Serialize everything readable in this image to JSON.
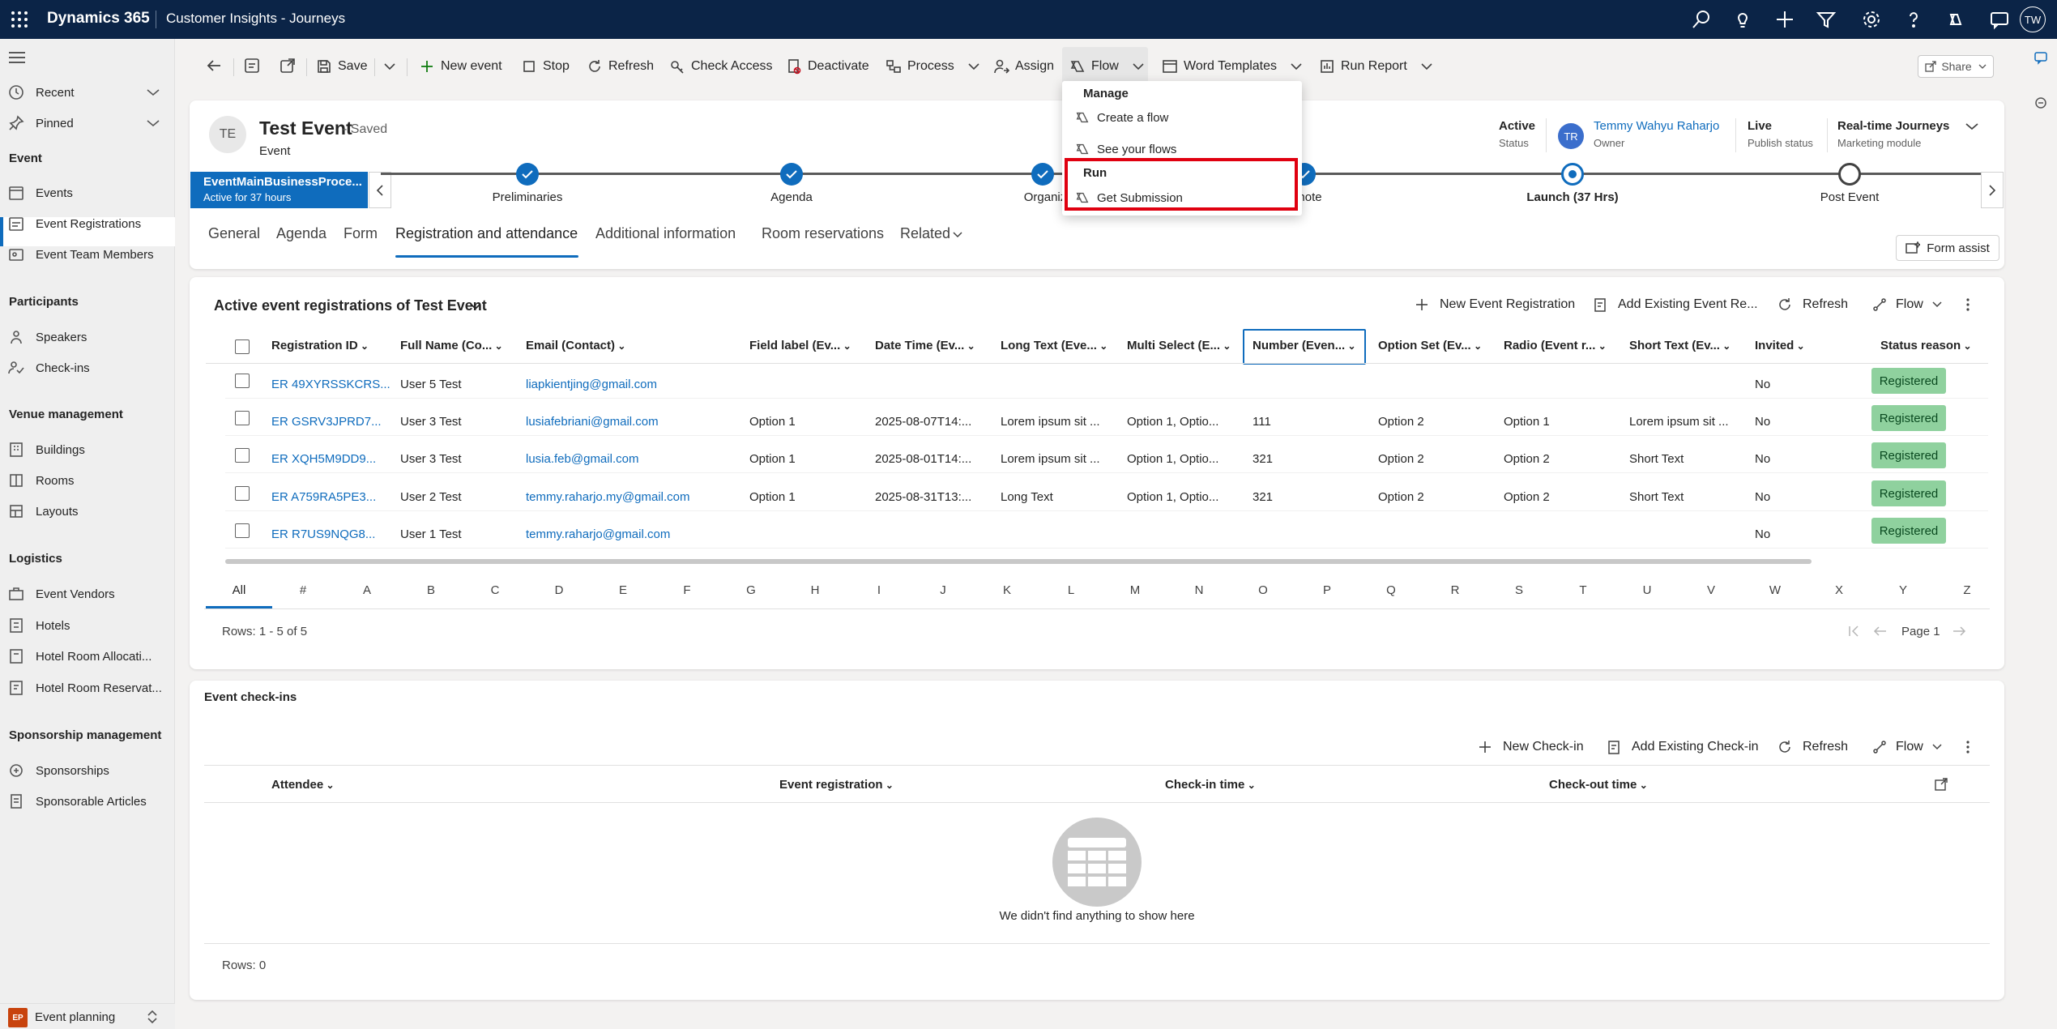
{
  "topbar": {
    "brand": "Dynamics 365",
    "app": "Customer Insights - Journeys",
    "user_initials": "TW",
    "icons": [
      "search-icon",
      "lightbulb-icon",
      "add-icon",
      "filter-icon",
      "settings-icon",
      "help-icon",
      "copilot-icon",
      "chat-icon"
    ]
  },
  "sidebar": {
    "top": [
      {
        "label": "Recent",
        "icon": "clock-icon"
      },
      {
        "label": "Pinned",
        "icon": "pin-icon"
      }
    ],
    "groups": [
      {
        "title": "Event",
        "items": [
          "Events",
          "Event Registrations",
          "Event Team Members"
        ]
      },
      {
        "title": "Participants",
        "items": [
          "Speakers",
          "Check-ins"
        ]
      },
      {
        "title": "Venue management",
        "items": [
          "Buildings",
          "Rooms",
          "Layouts"
        ]
      },
      {
        "title": "Logistics",
        "items": [
          "Event Vendors",
          "Hotels",
          "Hotel Room Allocati...",
          "Hotel Room Reservat..."
        ]
      },
      {
        "title": "Sponsorship management",
        "items": [
          "Sponsorships",
          "Sponsorable Articles"
        ]
      }
    ],
    "area": {
      "badge": "EP",
      "name": "Event planning"
    }
  },
  "command_bar": {
    "save": "Save",
    "new_event": "New event",
    "stop": "Stop",
    "refresh": "Refresh",
    "check_access": "Check Access",
    "deactivate": "Deactivate",
    "process": "Process",
    "assign": "Assign",
    "flow": "Flow",
    "word_templates": "Word Templates",
    "run_report": "Run Report",
    "share": "Share"
  },
  "flow_menu": {
    "manage": "Manage",
    "create": "Create a flow",
    "see": "See your flows",
    "run": "Run",
    "get_submission": "Get Submission"
  },
  "record": {
    "initials": "TE",
    "title": "Test Event",
    "saved": "- Saved",
    "type": "Event",
    "status_value": "Active",
    "status_label": "Status",
    "owner_initials": "TR",
    "owner_name": "Temmy Wahyu Raharjo",
    "owner_label": "Owner",
    "publish_value": "Live",
    "publish_label": "Publish status",
    "module_value": "Real-time Journeys",
    "module_label": "Marketing module"
  },
  "bpf": {
    "active_title": "EventMainBusinessProce...",
    "active_sub": "Active for 37 hours",
    "stages": [
      "Preliminaries",
      "Agenda",
      "Organiz",
      "note",
      "Launch  (37 Hrs)",
      "Post Event"
    ]
  },
  "tabs": [
    "General",
    "Agenda",
    "Form",
    "Registration and attendance",
    "Additional information",
    "Room reservations",
    "Related"
  ],
  "form_assist": "Form assist",
  "registrations": {
    "title": "Active event registrations of Test Event",
    "commands": {
      "new": "New Event Registration",
      "add": "Add Existing Event Re...",
      "refresh": "Refresh",
      "flow": "Flow"
    },
    "columns": [
      "Registration ID",
      "Full Name (Co...",
      "Email (Contact)",
      "Field label (Ev...",
      "Date Time (Ev...",
      "Long Text (Eve...",
      "Multi Select (E...",
      "Number (Even...",
      "Option Set (Ev...",
      "Radio (Event r...",
      "Short Text (Ev...",
      "Invited",
      "Status reason"
    ],
    "rows": [
      [
        "ER 49XYRSSKCRS...",
        "User 5 Test",
        "liapkientjing@gmail.com",
        "",
        "",
        "",
        "",
        "",
        "",
        "",
        "",
        "No",
        "Registered"
      ],
      [
        "ER GSRV3JPRD7...",
        "User 3 Test",
        "lusiafebriani@gmail.com",
        "Option 1",
        "2025-08-07T14:...",
        "Lorem ipsum sit ...",
        "Option 1, Optio...",
        "111",
        "Option 2",
        "Option 1",
        "Lorem ipsum sit ...",
        "No",
        "Registered"
      ],
      [
        "ER XQH5M9DD9...",
        "User 3 Test",
        "lusia.feb@gmail.com",
        "Option 1",
        "2025-08-01T14:...",
        "Lorem ipsum sit ...",
        "Option 1, Optio...",
        "321",
        "Option 2",
        "Option 2",
        "Short Text",
        "No",
        "Registered"
      ],
      [
        "ER A759RA5PE3...",
        "User 2 Test",
        "temmy.raharjo.my@gmail.com",
        "Option 1",
        "2025-08-31T13:...",
        "Long Text",
        "Option 1, Optio...",
        "321",
        "Option 2",
        "Option 2",
        "Short Text",
        "No",
        "Registered"
      ],
      [
        "ER R7US9NQG8...",
        "User 1 Test",
        "temmy.raharjo@gmail.com",
        "",
        "",
        "",
        "",
        "",
        "",
        "",
        "",
        "No",
        "Registered"
      ]
    ],
    "alpha": [
      "All",
      "#",
      "A",
      "B",
      "C",
      "D",
      "E",
      "F",
      "G",
      "H",
      "I",
      "J",
      "K",
      "L",
      "M",
      "N",
      "O",
      "P",
      "Q",
      "R",
      "S",
      "T",
      "U",
      "V",
      "W",
      "X",
      "Y",
      "Z"
    ],
    "rows_text": "Rows: 1 - 5 of 5",
    "page": "Page 1"
  },
  "checkins": {
    "title": "Event check-ins",
    "commands": {
      "new": "New Check-in",
      "add": "Add Existing Check-in",
      "refresh": "Refresh",
      "flow": "Flow"
    },
    "columns": [
      "Attendee",
      "Event registration",
      "Check-in time",
      "Check-out time"
    ],
    "empty": "We didn't find anything to show here",
    "rows_text": "Rows: 0"
  },
  "colors": {
    "topbar": "#0b2447",
    "accent": "#0f6cbd",
    "status_badge": "#8fd19e",
    "highlight": "#e00010"
  }
}
